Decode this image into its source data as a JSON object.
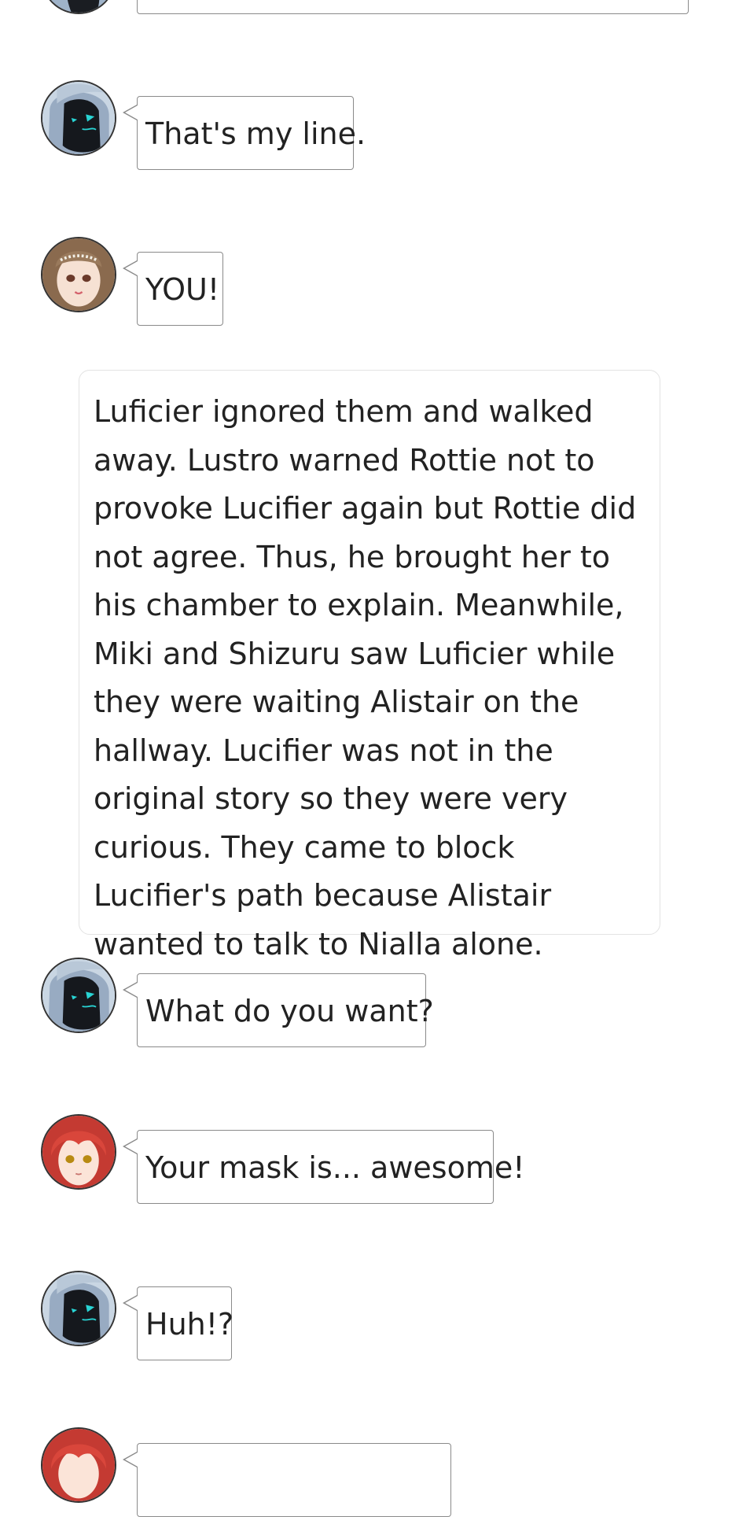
{
  "messages": [
    {
      "speaker": "masked-boy",
      "text": ""
    },
    {
      "speaker": "masked-boy",
      "text": "That's my line."
    },
    {
      "speaker": "brown-haired-girl",
      "text": "YOU!"
    },
    {
      "speaker": "masked-boy",
      "text": "What do you want?"
    },
    {
      "speaker": "red-haired-girl",
      "text": "Your mask is... awesome!"
    },
    {
      "speaker": "masked-boy",
      "text": "Huh!?"
    },
    {
      "speaker": "red-haired-girl",
      "text": ""
    }
  ],
  "narration": {
    "text": "Luficier ignored them and walked away. Lustro warned Rottie not to provoke Lucifier again but Rottie did not agree. Thus, he brought her to his chamber to explain. Meanwhile, Miki and Shizuru saw Luficier while they were waiting Alistair on the hallway. Lucifier was not in the original story so they were very curious. They came to block Lucifier's path because Alistair wanted to talk to Nialla alone."
  },
  "colors": {
    "bubble_border": "#8a8a8a",
    "narration_border": "#e3e3e3",
    "text": "#222222"
  }
}
